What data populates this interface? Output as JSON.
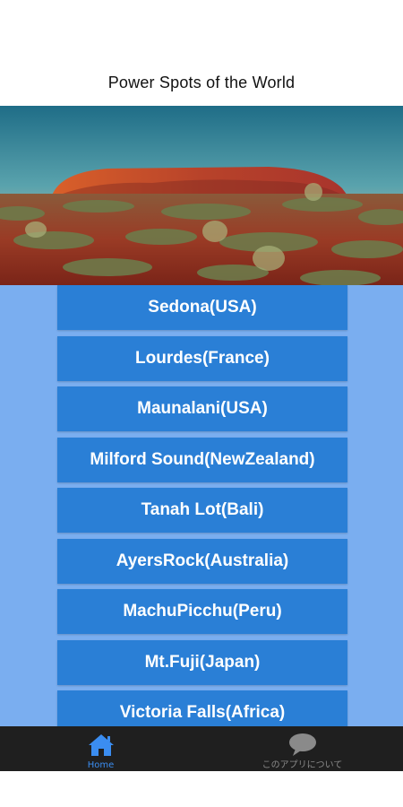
{
  "header": {
    "title": "Power Spots of the World"
  },
  "hero": {
    "description_icon": "ayers-rock-photo"
  },
  "spots": [
    {
      "label": "Sedona(USA)"
    },
    {
      "label": "Lourdes(France)"
    },
    {
      "label": "Maunalani(USA)"
    },
    {
      "label": "Milford Sound(NewZealand)"
    },
    {
      "label": "Tanah Lot(Bali)"
    },
    {
      "label": "AyersRock(Australia)"
    },
    {
      "label": "MachuPicchu(Peru)"
    },
    {
      "label": "Mt.Fuji(Japan)"
    },
    {
      "label": "Victoria Falls(Africa)"
    }
  ],
  "tabbar": {
    "home": {
      "label": "Home",
      "icon": "home-icon"
    },
    "about": {
      "label": "このアプリについて",
      "icon": "speech-bubble-icon"
    }
  },
  "colors": {
    "list_background": "#7aaef0",
    "button": "#2a7fd6",
    "button_text": "#ffffff",
    "tabbar": "#1f1f1f",
    "tab_active": "#3b8df0",
    "tab_inactive": "#8a8a8a"
  }
}
